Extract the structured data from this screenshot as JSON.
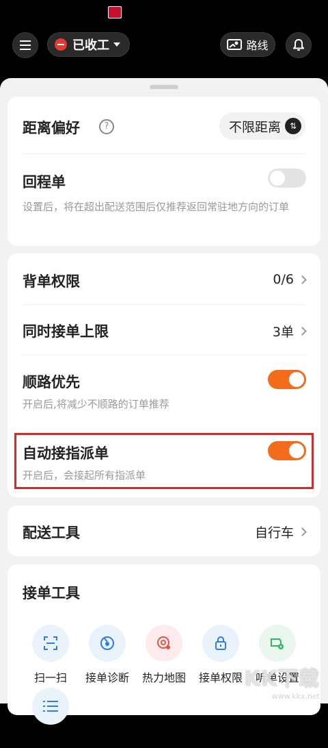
{
  "header": {
    "work_status": "已收工",
    "route_label": "路线"
  },
  "preferences": {
    "distance_title": "距离偏好",
    "distance_value": "不限距离",
    "return_title": "回程单",
    "return_desc": "设置后，将在超出配送范围后仅推荐返回常驻地方向的订单",
    "return_enabled": false
  },
  "orders": {
    "backlog_title": "背单权限",
    "backlog_value": "0/6",
    "limit_title": "同时接单上限",
    "limit_value": "3单",
    "route_pref_title": "顺路优先",
    "route_pref_desc": "开启后,将减少不顺路的订单推荐",
    "route_pref_enabled": true,
    "auto_accept_title": "自动接指派单",
    "auto_accept_desc": "开启后，会接起所有指派单",
    "auto_accept_enabled": true
  },
  "delivery": {
    "tool_title": "配送工具",
    "tool_value": "自行车"
  },
  "order_tools": {
    "title": "接单工具",
    "items": [
      {
        "label": "扫一扫",
        "icon": "scan-icon",
        "bg": "#eaf3fc",
        "color": "#2a7de1"
      },
      {
        "label": "接单诊断",
        "icon": "diagnosis-icon",
        "bg": "#eaf3fc",
        "color": "#2a7de1"
      },
      {
        "label": "热力地图",
        "icon": "heatmap-icon",
        "bg": "#fdeceb",
        "color": "#e5524a"
      },
      {
        "label": "接单权限",
        "icon": "lock-icon",
        "bg": "#eaf3fc",
        "color": "#2a7de1"
      },
      {
        "label": "听单设置",
        "icon": "listen-settings-icon",
        "bg": "#e9f7ee",
        "color": "#2fb566"
      },
      {
        "label": "",
        "icon": "list-icon",
        "bg": "#eaf3fc",
        "color": "#2a7de1"
      }
    ]
  },
  "watermark": {
    "brand": "KK下载",
    "url": "www.kkx.net"
  }
}
